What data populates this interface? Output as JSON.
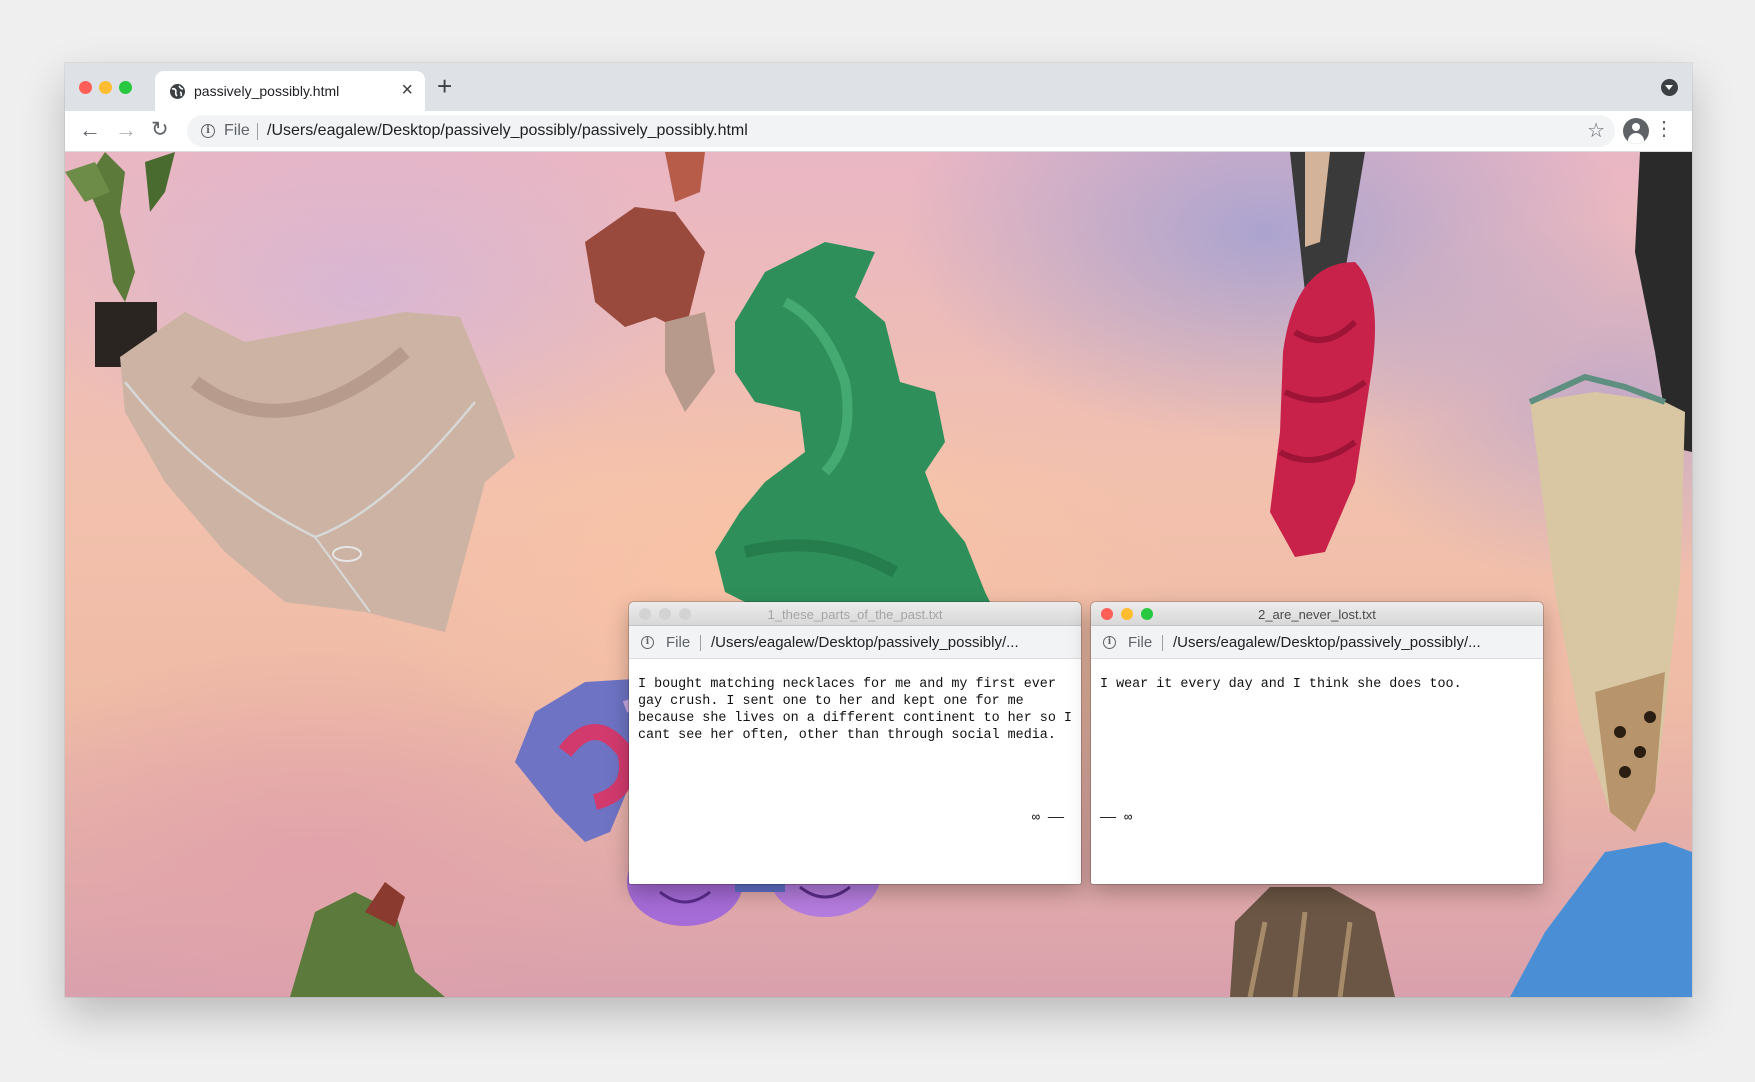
{
  "browser": {
    "tab_title": "passively_possibly.html",
    "tab_close": "×",
    "new_tab": "+",
    "scheme_label": "File",
    "url": "/Users/eagalew/Desktop/passively_possibly/passively_possibly.html"
  },
  "windows": [
    {
      "title": "1_these_parts_of_the_past.txt",
      "scheme_label": "File",
      "url": "/Users/eagalew/Desktop/passively_possibly/...",
      "body": "I bought matching necklaces for me and my first ever gay crush. I sent one to her and kept one for me because she lives on a different continent to her so I cant see her often, other than through social media.",
      "footer": "∞ ——",
      "active": false
    },
    {
      "title": "2_are_never_lost.txt",
      "scheme_label": "File",
      "url": "/Users/eagalew/Desktop/passively_possibly/...",
      "body": "I wear it every day and I think she does too.",
      "footer": "—— ∞",
      "active": true
    }
  ],
  "colors": {
    "close": "#ff5f57",
    "minimize": "#febc2e",
    "zoom": "#28c840",
    "inactive_dot": "#d3d3d3"
  }
}
